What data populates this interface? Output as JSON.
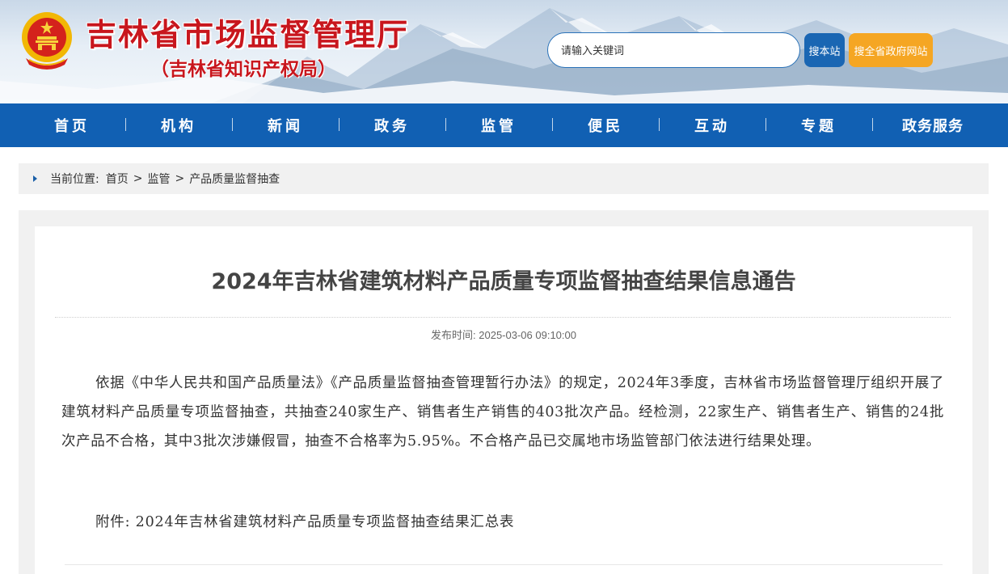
{
  "header": {
    "site_title": "吉林省市场监督管理厅",
    "site_subtitle": "（吉林省知识产权局）",
    "search_placeholder": "请输入关键词",
    "search_site_button": "搜本站",
    "search_gov_button": "搜全省政府网站"
  },
  "nav": {
    "items": [
      "首页",
      "机构",
      "新闻",
      "政务",
      "监管",
      "便民",
      "互动",
      "专题",
      "政务服务"
    ]
  },
  "breadcrumb": {
    "label": "当前位置:",
    "items": [
      "首页",
      "监管",
      "产品质量监督抽查"
    ],
    "separator": ">"
  },
  "article": {
    "title": "2024年吉林省建筑材料产品质量专项监督抽查结果信息通告",
    "publish_label": "发布时间:",
    "publish_time": "2025-03-06 09:10:00",
    "body": "依据《中华人民共和国产品质量法》《产品质量监督抽查管理暂行办法》的规定，2024年3季度，吉林省市场监督管理厅组织开展了建筑材料产品质量专项监督抽查，共抽查240家生产、销售者生产销售的403批次产品。经检测，22家生产、销售者生产、销售的24批次产品不合格，其中3批次涉嫌假冒，抽查不合格率为5.95%。不合格产品已交属地市场监管部门依法进行结果处理。",
    "attachment_label": "附件:",
    "attachment_name": "2024年吉林省建筑材料产品质量专项监督抽查结果汇总表"
  },
  "colors": {
    "title_red": "#c8161d",
    "nav_blue": "#1160b3",
    "search_blue": "#1a66b3",
    "search_orange": "#f5a623"
  },
  "icons": [
    "national-emblem-icon",
    "breadcrumb-arrow-icon"
  ]
}
